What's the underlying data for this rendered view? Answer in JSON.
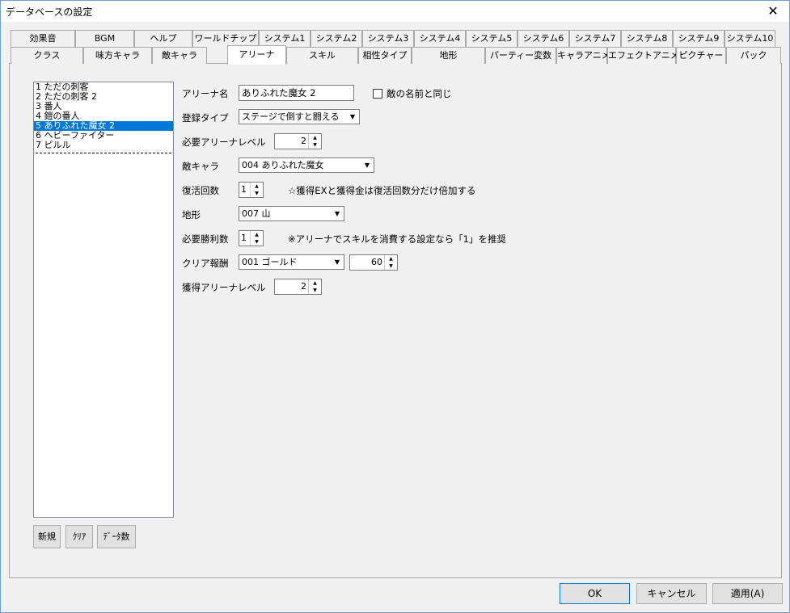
{
  "window": {
    "title": "データベースの設定",
    "close_glyph": "✕"
  },
  "tabs_row1": [
    "効果音",
    "BGM",
    "ヘルプ",
    "ワールドチップ",
    "システム1",
    "システム2",
    "システム3",
    "システム4",
    "システム5",
    "システム6",
    "システム7",
    "システム8",
    "システム9",
    "システム10"
  ],
  "tabs_row2": [
    "クラス",
    "味方キャラ",
    "敵キャラ",
    "アリーナ",
    "スキル",
    "相性タイプ",
    "地形",
    "パーティー変数",
    "キャラアニメ",
    "エフェクトアニメ",
    "ピクチャー",
    "パック"
  ],
  "active_tab": "アリーナ",
  "list": {
    "items": [
      "1 ただの刺客",
      "2 ただの刺客 2",
      "3 番人",
      "4 鎧の番人",
      "5 ありふれた魔女 2",
      "6 ヘビーファイター",
      "7 ピルル"
    ],
    "selected_index": 4
  },
  "list_buttons": {
    "new": "新規",
    "clear": "ｸﾘｱ",
    "count": "ﾃﾞｰﾀ数"
  },
  "form": {
    "arena_name": {
      "label": "アリーナ名",
      "value": "ありふれた魔女 2"
    },
    "same_as_enemy": {
      "label": "敵の名前と同じ",
      "checked": false
    },
    "reg_type": {
      "label": "登録タイプ",
      "value": "ステージで倒すと闘える"
    },
    "req_level": {
      "label": "必要アリーナレベル",
      "value": "2"
    },
    "enemy": {
      "label": "敵キャラ",
      "value": "004 ありふれた魔女"
    },
    "revive": {
      "label": "復活回数",
      "value": "1",
      "note": "☆獲得EXと獲得金は復活回数分だけ倍加する"
    },
    "terrain": {
      "label": "地形",
      "value": "007 山"
    },
    "wins": {
      "label": "必要勝利数",
      "value": "1",
      "note": "※アリーナでスキルを消費する設定なら「1」を推奨"
    },
    "reward": {
      "label": "クリア報酬",
      "value": "001 ゴールド",
      "amount": "60"
    },
    "gain_level": {
      "label": "獲得アリーナレベル",
      "value": "2"
    }
  },
  "footer": {
    "ok": "OK",
    "cancel": "キャンセル",
    "apply": "適用(A)"
  }
}
